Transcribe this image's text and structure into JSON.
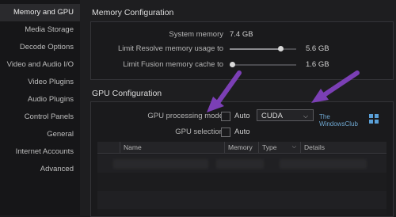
{
  "sidebar": {
    "items": [
      {
        "label": "Memory and GPU",
        "active": true
      },
      {
        "label": "Media Storage"
      },
      {
        "label": "Decode Options"
      },
      {
        "label": "Video and Audio I/O"
      },
      {
        "label": "Video Plugins"
      },
      {
        "label": "Audio Plugins"
      },
      {
        "label": "Control Panels"
      },
      {
        "label": "General"
      },
      {
        "label": "Internet Accounts"
      },
      {
        "label": "Advanced"
      }
    ]
  },
  "memory": {
    "title": "Memory Configuration",
    "system_label": "System memory",
    "system_value": "7.4 GB",
    "resolve_label": "Limit Resolve memory usage to",
    "resolve_value": "5.6 GB",
    "resolve_fraction": 0.76,
    "fusion_label": "Limit Fusion memory cache to",
    "fusion_value": "1.6 GB",
    "fusion_fraction": 0.04
  },
  "gpu": {
    "title": "GPU Configuration",
    "mode_label": "GPU processing mode",
    "mode_auto_label": "Auto",
    "mode_value": "CUDA",
    "selection_label": "GPU selection",
    "selection_auto_label": "Auto",
    "table": {
      "columns": [
        "Name",
        "Memory",
        "Type",
        "Details"
      ]
    }
  },
  "watermark": {
    "line1": "The",
    "line2": "WindowsClub"
  },
  "colors": {
    "arrow": "#7b3fb5",
    "background": "#1e1e20"
  }
}
